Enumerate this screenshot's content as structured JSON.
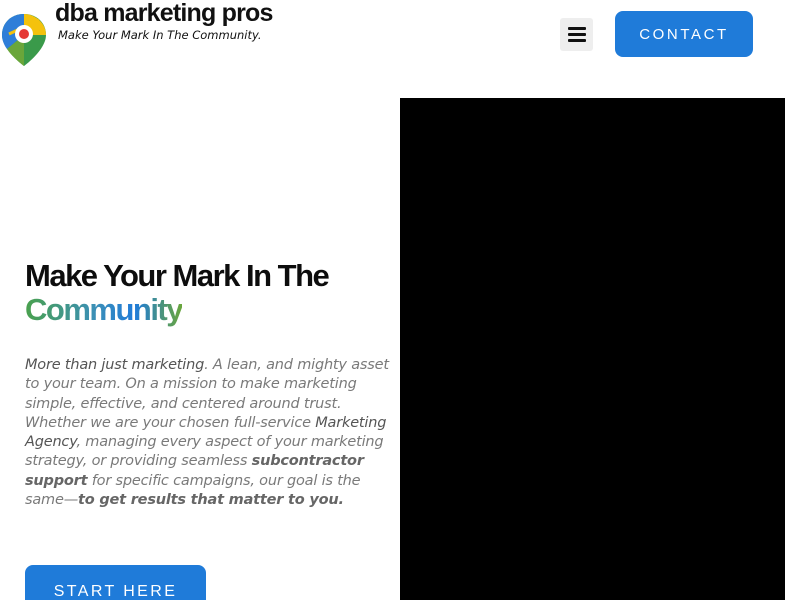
{
  "header": {
    "brand_name": "dba marketing pros",
    "tagline": "Make Your Mark In The Community.",
    "menu_icon": "hamburger-menu-icon",
    "contact_label": "CONTACT",
    "logo_icon": "map-pin-icon"
  },
  "hero": {
    "title_line1": "Make Your Mark In The",
    "title_line2": "Community",
    "body": {
      "p1_strong": "More than just marketing",
      "p1_rest": ". A lean, and mighty asset to your team. On a mission to make marketing simple, effective, and centered around trust. Whether we are your chosen full-service ",
      "marketing_agency": "Marketing Agency",
      "p2": ", managing every aspect of your marketing strategy, or providing seamless ",
      "subcontractor": "subcontractor support",
      "p3": " for specific campaigns, our goal is the same",
      "dash": "—",
      "closing": "to get results that matter to you."
    },
    "cta_label": "START HERE"
  },
  "video": {
    "state": "black"
  },
  "colors": {
    "accent_blue": "#1f7bd9",
    "gradient_green": "#4aa14d",
    "video_bg": "#000000"
  }
}
